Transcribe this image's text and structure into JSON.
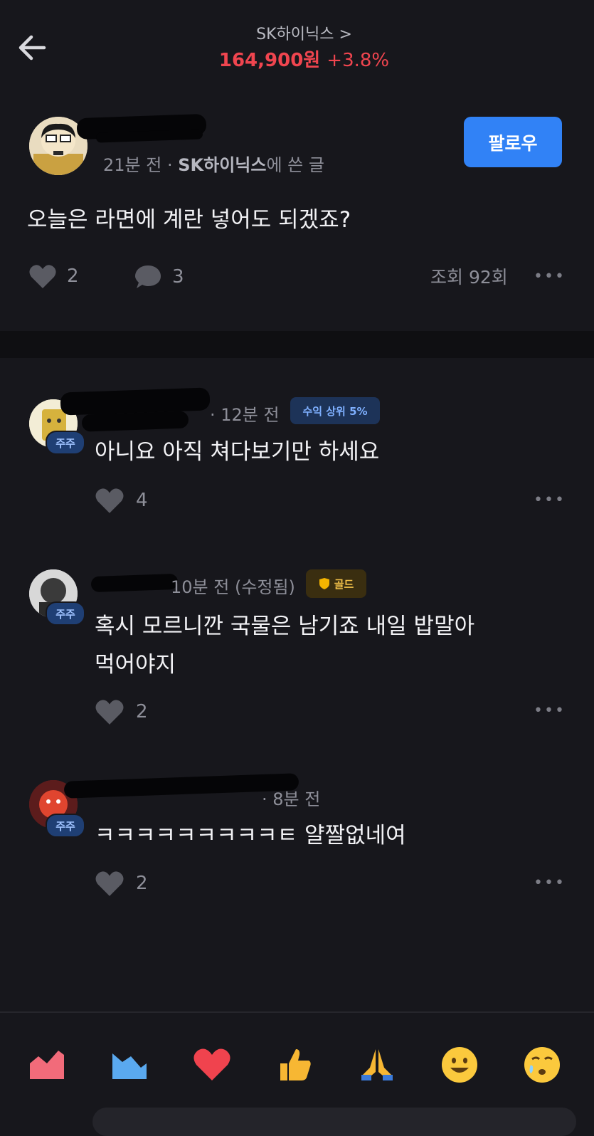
{
  "header": {
    "stock_name": "SK하이닉스 >",
    "price": "164,900원",
    "change": "+3.8%"
  },
  "post": {
    "time": "21분 전",
    "community": "SK하이닉스",
    "community_suffix": "에 쓴 글",
    "follow_label": "팔로우",
    "body": "오늘은 라면에 계란 넣어도 되겠죠?",
    "likes": "2",
    "comments": "3",
    "views": "조회 92회"
  },
  "comments": [
    {
      "time": "· 12분 전",
      "badge": "수익 상위 5%",
      "holder": "주주",
      "text": "아니요 아직 쳐다보기만 하세요",
      "likes": "4"
    },
    {
      "time": "10분 전 (수정됨)",
      "badge": "골드",
      "holder": "주주",
      "text_line1": "혹시 모르니깐 국물은 남기죠 내일 밥말아",
      "text_line2": "먹어야지",
      "likes": "2"
    },
    {
      "time": "· 8분 전",
      "holder": "주주",
      "text": "ㅋㅋㅋㅋㅋㅋㅋㅋㅋㅌ 얄짤없네여",
      "likes": "2"
    }
  ],
  "colors": {
    "background": "#17171c",
    "accent": "#3182f6",
    "price_up": "#f0454f",
    "gold": "#f4b400"
  },
  "reactions": [
    "chart-up-icon",
    "chart-down-icon",
    "heart-icon",
    "thumbs-up-icon",
    "pray-icon",
    "smile-icon",
    "tearful-icon"
  ]
}
